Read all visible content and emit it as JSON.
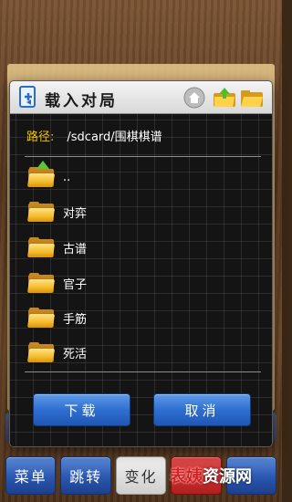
{
  "dialog": {
    "title": "载入对局",
    "title_icon": "file-open-icon",
    "header_buttons": [
      "home-icon",
      "folder-up-icon",
      "folder-open-icon"
    ],
    "path_label": "路径:",
    "path_value": "/sdcard/围棋棋谱",
    "items": [
      {
        "label": "..",
        "icon": "folder-up-icon"
      },
      {
        "label": "对弈",
        "icon": "folder-icon"
      },
      {
        "label": "古谱",
        "icon": "folder-icon"
      },
      {
        "label": "官子",
        "icon": "folder-icon"
      },
      {
        "label": "手筋",
        "icon": "folder-icon"
      },
      {
        "label": "死活",
        "icon": "folder-icon"
      }
    ],
    "download_button": "下载",
    "cancel_button": "取消"
  },
  "bottom_bar": {
    "menu": "菜单",
    "jump": "跳转",
    "variation": "变化"
  },
  "watermark": {
    "red": "表姨",
    "white": "资源网"
  },
  "colors": {
    "path_label": "#f2c200",
    "button_blue": "#2f6fd1",
    "dialog_bg": "#141414"
  }
}
